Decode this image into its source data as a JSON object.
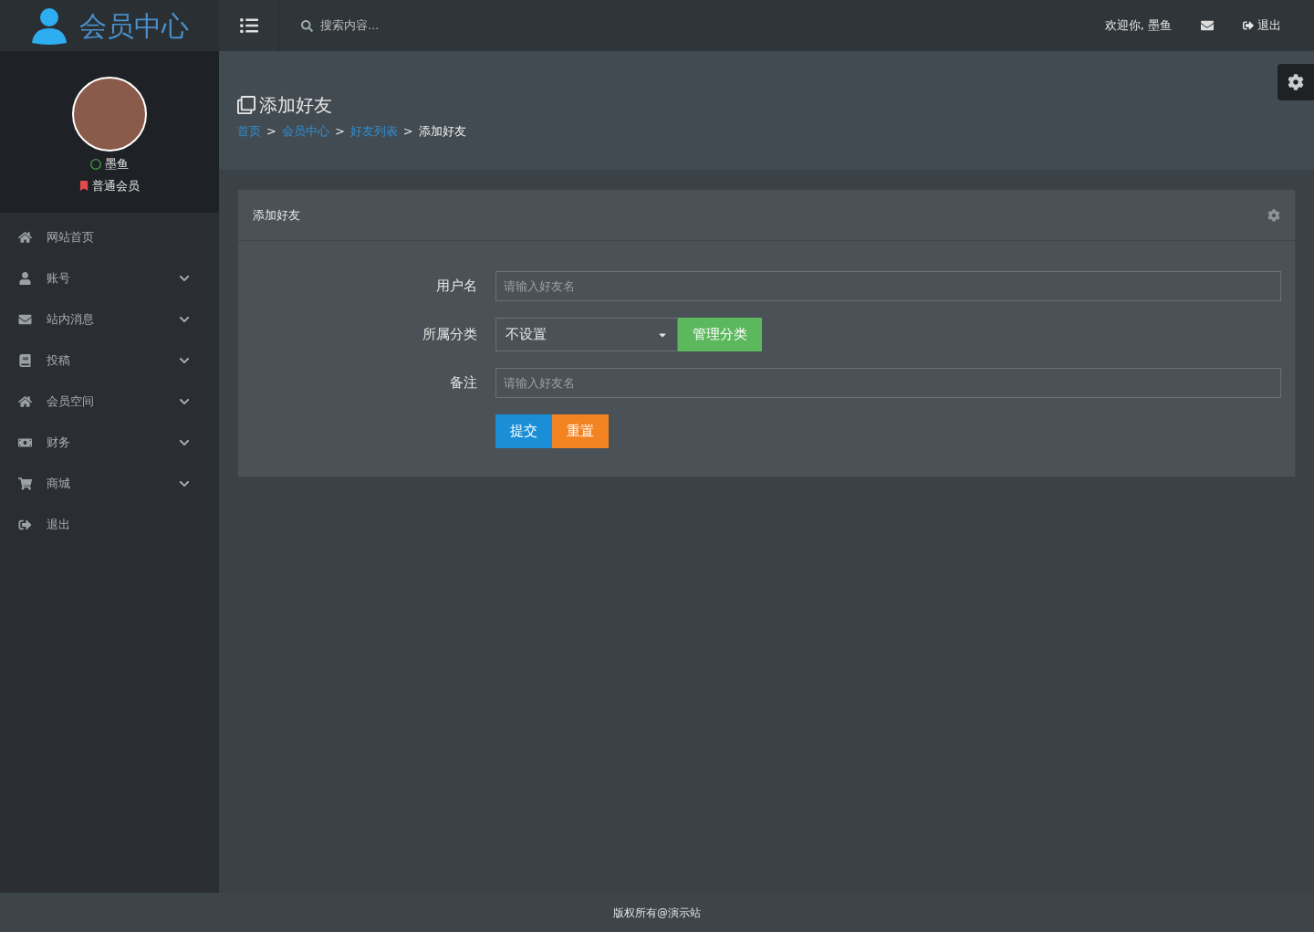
{
  "logo": {
    "title": "会员中心"
  },
  "topbar": {
    "search": {
      "placeholder": "搜索内容..."
    },
    "welcome": "欢迎你, 墨鱼",
    "logout": "退出"
  },
  "profile": {
    "name": "墨鱼",
    "online": true,
    "level": "普通会员"
  },
  "sidebar": {
    "items": [
      {
        "label": "网站首页",
        "expandable": false
      },
      {
        "label": "账号",
        "expandable": true
      },
      {
        "label": "站内消息",
        "expandable": true
      },
      {
        "label": "投稿",
        "expandable": true
      },
      {
        "label": "会员空间",
        "expandable": true
      },
      {
        "label": "财务",
        "expandable": true
      },
      {
        "label": "商城",
        "expandable": true
      },
      {
        "label": "退出",
        "expandable": false
      }
    ]
  },
  "page": {
    "title": "添加好友",
    "breadcrumb": [
      {
        "label": "首页",
        "link": true
      },
      {
        "label": "会员中心",
        "link": true
      },
      {
        "label": "好友列表",
        "link": true
      },
      {
        "label": "添加好友",
        "link": false
      }
    ],
    "separator": ">"
  },
  "panel": {
    "title": "添加好友",
    "fields": [
      {
        "kind": "text",
        "label": "用户名",
        "placeholder": "请输入好友名"
      },
      {
        "kind": "select",
        "label": "所属分类",
        "value": "不设置",
        "button": "管理分类"
      },
      {
        "kind": "text",
        "label": "备注",
        "placeholder": "请输入好友名"
      }
    ],
    "buttons": [
      {
        "label": "提交",
        "kind": "primary"
      },
      {
        "label": "重置",
        "kind": "warning"
      }
    ]
  },
  "footer": "版权所有@演示站"
}
